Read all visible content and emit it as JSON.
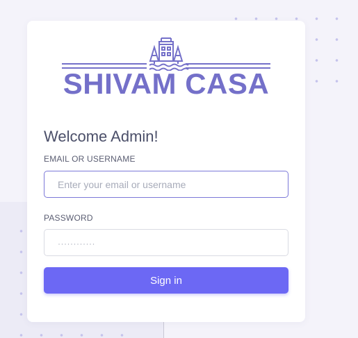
{
  "brand": {
    "name": "SHIVAM CASA",
    "logo_icon": "castle-trees-water-icon",
    "color": "#7470c9"
  },
  "login": {
    "heading": "Welcome Admin!",
    "email_label": "EMAIL OR USERNAME",
    "email_placeholder": "Enter your email or username",
    "password_label": "PASSWORD",
    "password_placeholder": "············",
    "submit_label": "Sign in"
  },
  "colors": {
    "accent": "#6c68f4",
    "focus_border": "#7b78d8",
    "text": "#4b4f69",
    "background": "#f4f3fa"
  }
}
